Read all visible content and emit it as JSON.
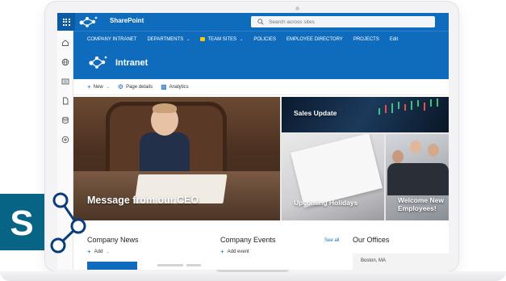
{
  "suite_bar": {
    "app_name": "SharePoint",
    "search_placeholder": "Search across sites"
  },
  "hub_nav": {
    "items": [
      {
        "label": "COMPANY INTRANET",
        "dropdown": false
      },
      {
        "label": "DEPARTMENTS",
        "dropdown": true
      },
      {
        "label": "TEAM SITES",
        "dropdown": true
      },
      {
        "label": "POLICIES",
        "dropdown": false
      },
      {
        "label": "EMPLOYEE DIRECTORY",
        "dropdown": false
      },
      {
        "label": "PROJECTS",
        "dropdown": false
      },
      {
        "label": "Edit",
        "dropdown": false
      }
    ]
  },
  "site_header": {
    "title": "Intranet"
  },
  "command_bar": {
    "new_label": "New",
    "page_details_label": "Page details",
    "analytics_label": "Analytics"
  },
  "hero": {
    "main_title": "Message from our CEO",
    "tile_sales": "Sales Update",
    "tile_holidays": "Upcoming Holidays",
    "tile_welcome": "Welcome New Employees!"
  },
  "company_news": {
    "title": "Company News",
    "add_label": "Add"
  },
  "company_events": {
    "title": "Company Events",
    "see_all": "See all",
    "add_label": "Add event"
  },
  "our_offices": {
    "title": "Our Offices",
    "first_office": "Boston, MA"
  },
  "colors": {
    "brand_blue": "#0f6cbd",
    "sharepoint_logo_blue": "#036c70"
  },
  "icons": [
    "app-launcher-icon",
    "sharepoint-logo-icon",
    "search-icon",
    "home-icon",
    "globe-icon",
    "news-icon",
    "document-icon",
    "database-icon",
    "add-circle-icon",
    "page-details-icon",
    "analytics-icon",
    "sharepoint-big-logo"
  ]
}
